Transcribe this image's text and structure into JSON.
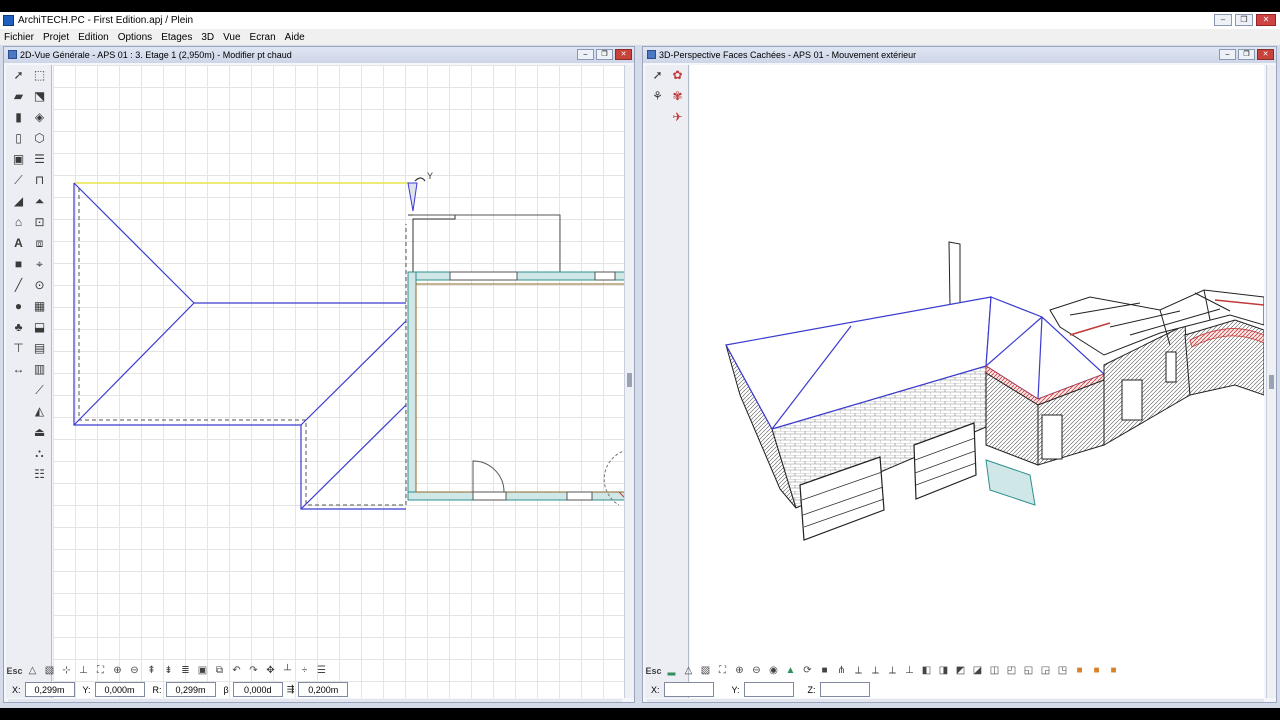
{
  "app": {
    "title": "ArchiTECH.PC - First Edition.apj / Plein"
  },
  "window_controls": {
    "minimize": "‒",
    "restore": "❐",
    "close": "✕"
  },
  "menu": [
    "Fichier",
    "Projet",
    "Edition",
    "Options",
    "Etages",
    "3D",
    "Vue",
    "Ecran",
    "Aide"
  ],
  "view2d": {
    "title": "2D-Vue Générale - APS 01 : 3. Etage 1 (2,950m) - Modifier pt chaud",
    "esc_label": "Esc",
    "coords": {
      "x_label": "X:",
      "x_value": "0,299m",
      "y_label": "Y:",
      "y_value": "0,000m",
      "r_label": "R:",
      "r_value": "0,299m",
      "b_label": "β",
      "b_value": "0,000d",
      "h_value": "0,200m"
    },
    "cursor_label": "Y"
  },
  "view3d": {
    "title": "3D-Perspective Faces Cachées - APS 01 - Mouvement extérieur",
    "esc_label": "Esc",
    "coords": {
      "x_label": "X:",
      "x_value": "",
      "y_label": "Y:",
      "y_value": "",
      "z_label": "Z:",
      "z_value": ""
    }
  },
  "colors": {
    "roof_line": "#3b3bd0",
    "wall_hatch": "#2f8f8f",
    "brick": "#c23a3a",
    "grid": "#e4e4e4"
  }
}
